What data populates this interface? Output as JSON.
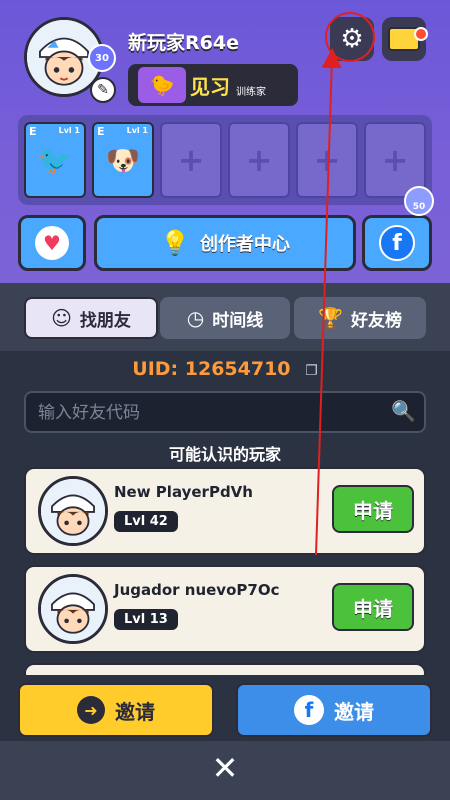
{
  "profile": {
    "username": "新玩家R64e",
    "level": "30",
    "rank_title": "见习",
    "rank_sub": "训练家"
  },
  "slots": [
    {
      "tier": "E",
      "level": "Lvl 1",
      "filled": true
    },
    {
      "tier": "E",
      "level": "Lvl 1",
      "filled": true
    },
    {
      "filled": false,
      "plus": "+"
    },
    {
      "filled": false,
      "plus": "+"
    },
    {
      "filled": false,
      "plus": "+"
    },
    {
      "filled": false,
      "plus": "+"
    }
  ],
  "actions": {
    "creator_center": "创作者中心",
    "gem_count": "50"
  },
  "tabs": [
    {
      "label": "找朋友",
      "icon": "search-face-icon"
    },
    {
      "label": "时间线",
      "icon": "clock-icon"
    },
    {
      "label": "好友榜",
      "icon": "trophy-icon"
    }
  ],
  "uid": {
    "label": "UID: 12654710"
  },
  "search": {
    "placeholder": "输入好友代码"
  },
  "section_title": "可能认识的玩家",
  "players": [
    {
      "name": "New PlayerPdVh",
      "level": "Lvl 42",
      "action": "申请"
    },
    {
      "name": "Jugador nuevoP7Oc",
      "level": "Lvl 13",
      "action": "申请"
    }
  ],
  "bottom": {
    "invite_label": "邀请",
    "invite_fb_label": "邀请"
  },
  "colors": {
    "accent_purple": "#6b58d8",
    "apply_green": "#4cc23c",
    "uid_orange": "#ff9a3c",
    "annotation_red": "#e02020"
  }
}
